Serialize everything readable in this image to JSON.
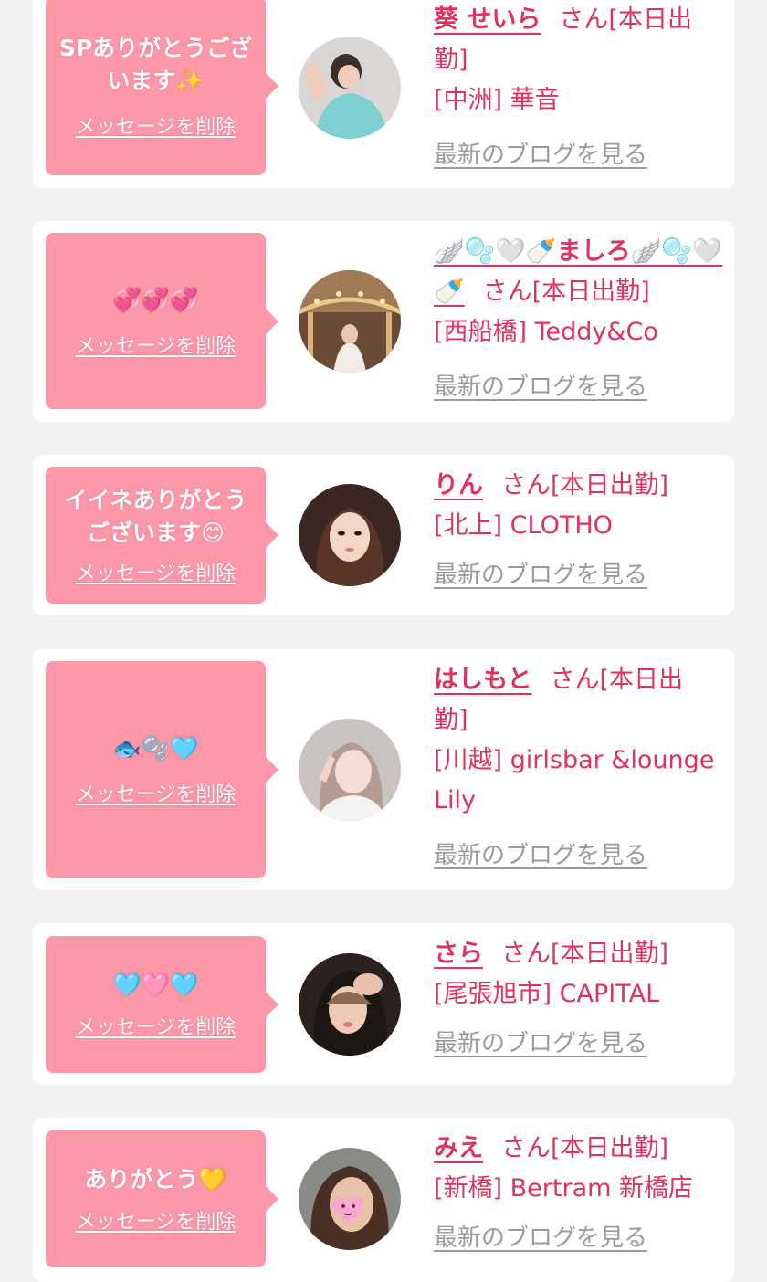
{
  "delete_label": "メッセージを削除",
  "blog_label": "最新のブログを見る",
  "cards": [
    {
      "message": "SPありがとうございます✨",
      "name": "葵 せいら",
      "san": "さん[本日出勤]",
      "shop": "[中洲] 華音"
    },
    {
      "message": "💞💞💞",
      "name": "🪽🫧🤍🍼ましろ🪽🫧🤍🍼",
      "san": "さん[本日出勤]",
      "shop": "[西船橋] Teddy&Co"
    },
    {
      "message": "イイネありがとうございます😊",
      "name": "りん",
      "san": "さん[本日出勤]",
      "shop": "[北上] CLOTHO"
    },
    {
      "message": "🐟🫧🩵",
      "name": "はしもと",
      "san": "さん[本日出勤]",
      "shop": "[川越] girlsbar &lounge Lily"
    },
    {
      "message": "🩵🩷🩵",
      "name": "さら",
      "san": "さん[本日出勤]",
      "shop": "[尾張旭市] CAPITAL"
    },
    {
      "message": "ありがとう💛",
      "name": "みえ",
      "san": "さん[本日出勤]",
      "shop": "[新橋] Bertram 新橋店"
    }
  ]
}
